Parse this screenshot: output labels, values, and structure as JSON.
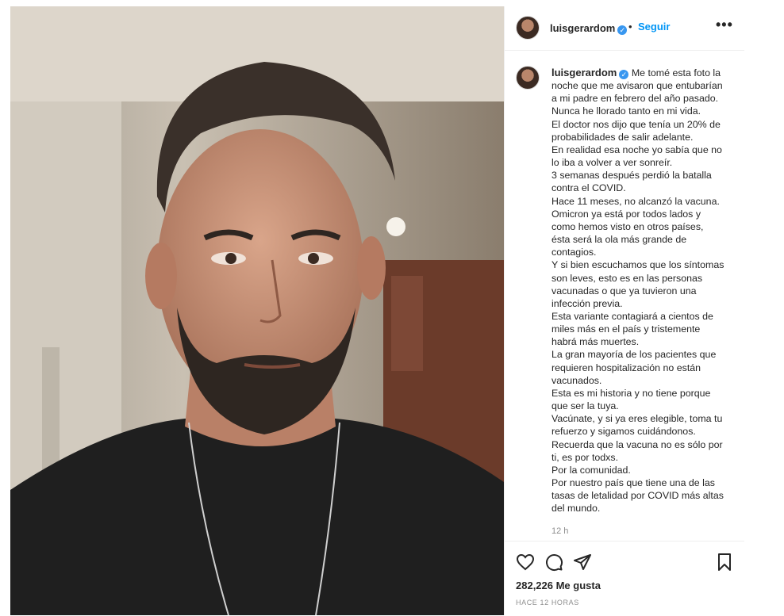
{
  "post": {
    "photo_alt": "Foto de perfil de un hombre con barba y camiseta negra",
    "username": "luisgerardom",
    "verified_icon": "✓",
    "separator": "•",
    "follow_label": "Seguir",
    "more_label": "•••",
    "caption_lines": [
      "Me tomé esta foto la",
      "noche que me avisaron que entubarían",
      "a mi padre en febrero del año pasado.",
      "Nunca he llorado tanto en mi vida.",
      "El doctor nos dijo que tenía un 20% de",
      "probabilidades de salir adelante.",
      "En realidad esa noche yo sabía que no",
      "lo iba a volver a ver sonreír.",
      "3 semanas después perdió la batalla",
      "contra el COVID.",
      "Hace 11 meses, no alcanzó la vacuna.",
      "Omicron ya está por todos lados y",
      "como hemos visto en otros países,",
      "ésta será la ola más grande de",
      "contagios.",
      "Y si bien escuchamos que los síntomas",
      "son leves, esto es en las personas",
      "vacunadas o que ya tuvieron una",
      "infección previa.",
      "Esta variante contagiará a cientos de",
      "miles más en el país y tristemente",
      "habrá más muertes.",
      "La gran mayoría de los pacientes que",
      "requieren hospitalización no están",
      "vacunados.",
      "Esta es mi historia y no tiene porque",
      "que ser la tuya.",
      "Vacúnate, y si ya eres elegible, toma tu",
      "refuerzo y sigamos cuidándonos.",
      "Recuerda que la vacuna no es sólo por",
      "ti, es por todxs.",
      "Por la comunidad.",
      "Por nuestro país que tiene una de las",
      "tasas de letalidad por COVID más altas",
      "del mundo."
    ],
    "time_ago": "12 h",
    "likes": "282,226 Me gusta",
    "date": "HACE 12 HORAS"
  },
  "icons": [
    "heart-icon",
    "comment-icon",
    "share-icon",
    "bookmark-icon"
  ]
}
